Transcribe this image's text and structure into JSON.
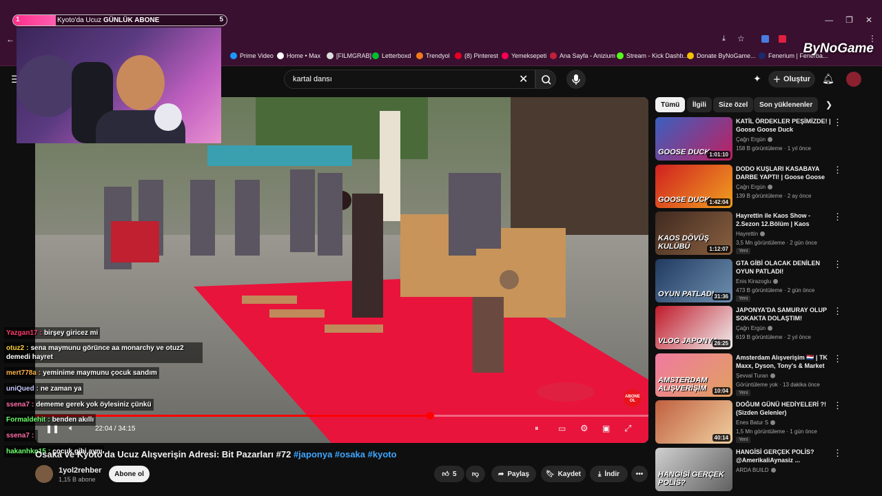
{
  "browser": {
    "goal": {
      "left": "1",
      "label_prefix": "Kyoto'da Ucuz ",
      "label_bold": "GÜNLÜK ABONE",
      "right": "5",
      "fraction": 0.2
    },
    "window_controls": [
      "—",
      "❐",
      "✕"
    ],
    "bookmarks": [
      {
        "label": "Prime Video",
        "color": "#1a98ff"
      },
      {
        "label": "Home • Max",
        "color": "#ffffff"
      },
      {
        "label": "[FILMGRAB]",
        "color": "#dddddd"
      },
      {
        "label": "Letterboxd",
        "color": "#00c030"
      },
      {
        "label": "Trendyol",
        "color": "#f27a1a"
      },
      {
        "label": "(8) Pinterest",
        "color": "#e60023"
      },
      {
        "label": "Yemeksepeti",
        "color": "#fa0050"
      },
      {
        "label": "Ana Sayfa - Anizium",
        "color": "#c0203a"
      },
      {
        "label": "Stream - Kick Dashb...",
        "color": "#53fc18"
      },
      {
        "label": "Donate ByNoGame...",
        "color": "#f2c200"
      },
      {
        "label": "Fenerium | Fenerba...",
        "color": "#1a2a6a"
      }
    ],
    "brand": "ByNoGame"
  },
  "youtube": {
    "search": {
      "value": "kartal dansı"
    },
    "create_label": "Oluştur",
    "video": {
      "title_plain": "Osaka ve Kyoto'da Ucuz Alışverişin Adresi: Bit Pazarları #72",
      "title_tags": " #japonya #osaka #kyoto",
      "time": "22:04 / 34:15",
      "progress": 0.644,
      "abone_badge": "ABONE OL"
    },
    "channel": {
      "name": "1yol2rehber",
      "subs": "1,15 B abone",
      "subscribe_label": "Abone ol"
    },
    "actions": {
      "likes": "5",
      "share": "Paylaş",
      "save": "Kaydet",
      "download": "İndir",
      "more": "•••"
    },
    "chips": [
      "Tümü",
      "İlgili",
      "Size özel",
      "Son yüklenenler"
    ],
    "recommendations": [
      {
        "title": "KATİL ÖRDEKLER PEŞİMİZDE! | Goose Goose Duck",
        "channel": "Çağrı Ergün",
        "meta": "158 B görüntüleme · 1 yıl önce",
        "duration": "1:01:10",
        "badge": "",
        "thumb_text": "GOOSE DUCK",
        "c1": "#3a60c0",
        "c2": "#c02060"
      },
      {
        "title": "DODO KUŞLARI KASABAYA DARBE YAPTI! | Goose Goose ...",
        "channel": "Çağrı Ergün",
        "meta": "139 B görüntüleme · 2 ay önce",
        "duration": "1:42:04",
        "badge": "",
        "thumb_text": "GOOSE DUCK",
        "c1": "#d02020",
        "c2": "#f0a020"
      },
      {
        "title": "Hayrettin ile Kaos Show - 2.Sezon 12.Bölüm | Kaos Dövü...",
        "channel": "Hayrettin",
        "meta": "3,5 Mn görüntüleme · 2 gün önce",
        "duration": "1:12:07",
        "badge": "Yeni",
        "thumb_text": "KAOS DÖVÜŞ KULÜBÜ",
        "c1": "#402a20",
        "c2": "#8a6040"
      },
      {
        "title": "GTA GİBİ OLACAK DENİLEN OYUN PATLADI! TÜRKİYE'DEKİ...",
        "channel": "Enis Kirazoglu",
        "meta": "473 B görüntüleme · 2 gün önce",
        "duration": "31:36",
        "badge": "Yeni",
        "thumb_text": "OYUN PATLADI",
        "c1": "#203a60",
        "c2": "#7090b0"
      },
      {
        "title": "JAPONYA'DA SAMURAY OLUP SOKAKTA DOLAŞTIM! (EFSAN...",
        "channel": "Çağrı Ergün",
        "meta": "619 B görüntüleme · 2 yıl önce",
        "duration": "26:25",
        "badge": "",
        "thumb_text": "VLOG JAPONYA",
        "c1": "#c01a2a",
        "c2": "#f0f0f0"
      },
      {
        "title": "Amsterdam Alışverişim 🇳🇱 | TK Maxx, Dyson, Tony's & Market ...",
        "channel": "Şevval Turan",
        "meta": "Görüntüleme yok · 13 dakika önce",
        "duration": "10:04",
        "badge": "Yeni",
        "thumb_text": "AMSTERDAM ALIŞVERİŞİM",
        "c1": "#f07aa0",
        "c2": "#e0a060"
      },
      {
        "title": "DOĞUM GÜNÜ HEDİYELERİ ?! (Sizden Gelenler)",
        "channel": "Enes Batur S",
        "meta": "1,5 Mn görüntüleme · 1 gün önce",
        "duration": "40:14",
        "badge": "Yeni",
        "thumb_text": "",
        "c1": "#c06040",
        "c2": "#f0d0a0"
      },
      {
        "title": "HANGİSİ GERÇEK POLİS? @AmerikaliAynasiz ...",
        "channel": "ARDA BUILD",
        "meta": "",
        "duration": "",
        "badge": "",
        "thumb_text": "HANGİSİ GERÇEK POLİS?",
        "c1": "#d0d0d0",
        "c2": "#606060"
      }
    ]
  },
  "chat": [
    {
      "user": "Yazgan17",
      "msg": "birşey giricez mi",
      "color": "#ff3b6b"
    },
    {
      "user": "otuz2",
      "msg": "sena maymunu görünce aa monarchy ve otuz2 demedi hayret",
      "color": "#ffd23b"
    },
    {
      "user": "mert778a",
      "msg": "yeminime maymunu çocuk sandım",
      "color": "#ffb24a"
    },
    {
      "user": "uniQued",
      "msg": "ne zaman ya",
      "color": "#c8c8ff"
    },
    {
      "user": "ssena7",
      "msg": "dememe gerek yok öylesiniz çünkü",
      "color": "#ff6fa8"
    },
    {
      "user": "Formaldehit",
      "msg": "benden akıllı",
      "color": "#6cff6c"
    },
    {
      "user": "ssena7",
      "msg": "",
      "color": "#ff6fa8"
    },
    {
      "user": "hakanhkn15",
      "msg": "çocuk gibi aynı",
      "color": "#6cff6c"
    }
  ]
}
